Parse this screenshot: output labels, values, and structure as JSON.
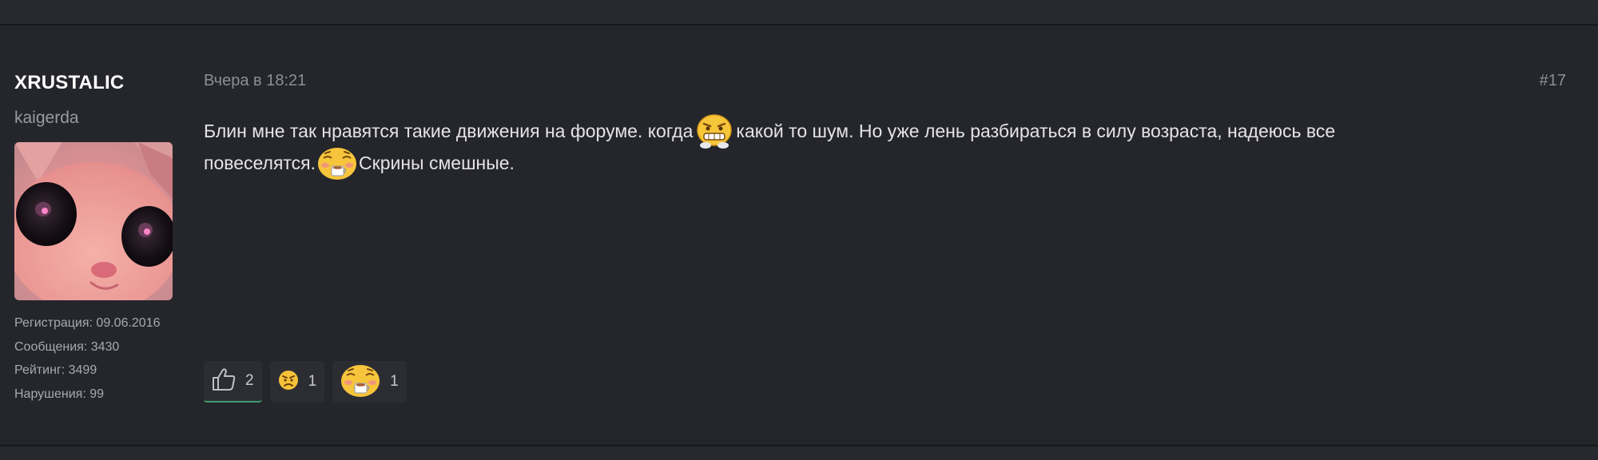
{
  "user": {
    "name": "XRUSTALIC",
    "title": "kaigerda",
    "avatar_icon": "cat-avatar",
    "stats": [
      {
        "label": "Регистрация: 09.06.2016"
      },
      {
        "label": "Сообщения: 3430"
      },
      {
        "label": "Рейтинг: 3499"
      },
      {
        "label": "Нарушения: 99"
      }
    ]
  },
  "post": {
    "date": "Вчера в 18:21",
    "number": "#17",
    "line1_a": "Блин мне так нравятся такие движения на форуме. когда ",
    "line1_b": "какой то шум. Но уже лень разбираться в силу возраста, надеюсь все",
    "line2_a": "повеселятся.",
    "line2_b": "Скрины смешные.",
    "emoji1": "grimace-emoji",
    "emoji2": "tea-sipping-emoji"
  },
  "reactions": [
    {
      "icon": "thumbs-up-icon",
      "count": "2",
      "active": true
    },
    {
      "icon": "angry-face-icon",
      "count": "1",
      "active": false
    },
    {
      "icon": "tea-sipping-emoji",
      "count": "1",
      "active": false
    }
  ],
  "colors": {
    "background": "#25262b",
    "username": "#ffffff",
    "active_reaction_border": "#3f9e6e"
  }
}
